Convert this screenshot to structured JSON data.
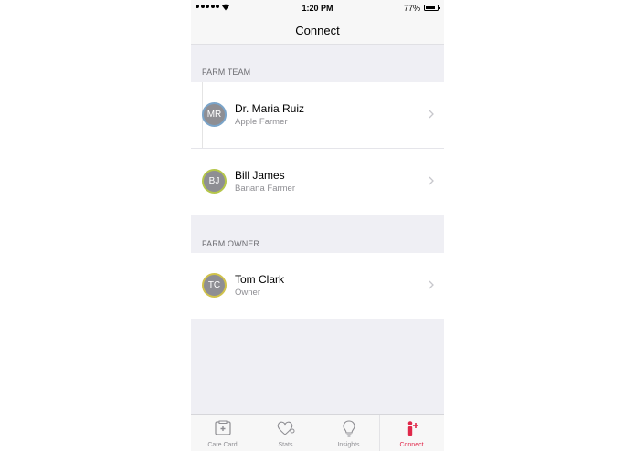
{
  "status_bar": {
    "time": "1:20 PM",
    "battery": "77%"
  },
  "nav": {
    "title": "Connect"
  },
  "sections": [
    {
      "header": "FARM TEAM",
      "contacts": [
        {
          "initials": "MR",
          "name": "Dr. Maria Ruiz",
          "role": "Apple Farmer"
        },
        {
          "initials": "BJ",
          "name": "Bill James",
          "role": "Banana Farmer"
        }
      ]
    },
    {
      "header": "FARM OWNER",
      "contacts": [
        {
          "initials": "TC",
          "name": "Tom Clark",
          "role": "Owner"
        }
      ]
    }
  ],
  "tabs": [
    {
      "label": "Care Card",
      "icon": "care-card-icon",
      "active": false
    },
    {
      "label": "Stats",
      "icon": "stats-heart-icon",
      "active": false
    },
    {
      "label": "Insights",
      "icon": "lightbulb-icon",
      "active": false
    },
    {
      "label": "Connect",
      "icon": "connect-person-icon",
      "active": true
    }
  ],
  "colors": {
    "accent": "#e0284a",
    "avatar_ring_mr": "#7aa4c9",
    "avatar_ring_bj": "#b5c64a",
    "avatar_ring_tc": "#d0c24b"
  }
}
